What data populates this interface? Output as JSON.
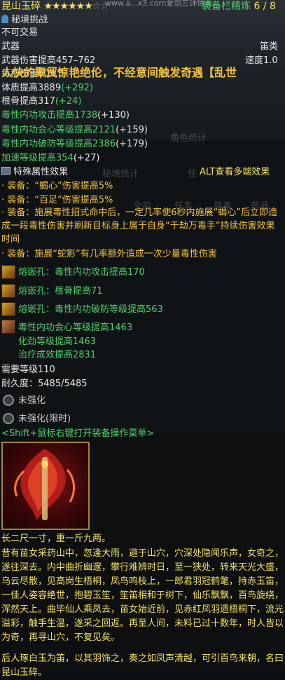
{
  "header": {
    "item_name": "昆山玉碎",
    "stars_filled": "★★★★★★",
    "stars_empty": "☆☆",
    "watermark": "www.a...x3.com爱剑三详情看...",
    "refine_label": "装备栏精炼",
    "refine_value": "6 / 8"
  },
  "source": "秘境挑战",
  "bind": "不可交易",
  "slot": "武器",
  "weapon_type": "笛类",
  "damage": "武器伤害提高457–762",
  "speed": "速度1.0",
  "banner": "人快的聚贸惊艳绝伦，不经意间触发奇遇【乱世",
  "ghost_text": "每秒伤害609.5",
  "stats": [
    {
      "base": "体质提高3889",
      "bonus": "(+292)",
      "color": "w"
    },
    {
      "base": "根骨提高317",
      "bonus": "(+24)",
      "color": "w"
    },
    {
      "base": "毒性内功攻击提高1738",
      "bonus": "(+130)",
      "color": "g"
    },
    {
      "base": "毒性内功会心等级提高2121",
      "bonus": "(+159)",
      "color": "g"
    },
    {
      "base": "毒性内功破防等级提高2386",
      "bonus": "(+179)",
      "color": "g"
    },
    {
      "base": "加速等级提高354",
      "bonus": "(+27)",
      "color": "g"
    }
  ],
  "background_tabs": {
    "role_stats": "角色统计",
    "secret_stats": "秘境统计",
    "cn_label": "任",
    "tabs": [
      "全部",
      "任务",
      "装备",
      "药品"
    ]
  },
  "special": {
    "title": "特殊属性效果",
    "alt_hint": "ALT查看多端效果",
    "effects": [
      "· 装备：“蝎心”伤害提高5%",
      "· 装备：“百足”伤害提高5%",
      "· 装备：施展毒性招式命中后，一定几率使6秒内施展“蝎心”后立即造成一段毒性伤害并刷新目标身上属于自身“千劫万毒手”持续伤害效果时间",
      "· 装备：施展“蛇影”有几率额外造成一次少量毒性伤害"
    ]
  },
  "sockets": [
    "熔嵌孔：毒性内功攻击提高170",
    "熔嵌孔：根骨提高71",
    "熔嵌孔：毒性内功破防等级提高563"
  ],
  "enchant": [
    "毒性内功会心等级提高1463",
    "化劲等级提高1463",
    "治疗成效提高2831"
  ],
  "level_req": "需要等级110",
  "durability": "耐久度：5485/5485",
  "strengthen": [
    "未强化",
    "未强化(限时)"
  ],
  "menu_hint": "<Shift+鼠标右键打开装备操作菜单>",
  "size_desc": "长二尺一寸，重一斤九两。",
  "lore": "昔有苗女采药山中，忽逢大雨，避于山穴，穴深处隐闻乐声，女奇之，遂往深去。内中曲折幽邃，攀行难辨时日，至一狭处，转来天光大盛，乌云尽散，见高岗生梧桐，凤鸟鸣枝上，一郎君羽冠鹤氅，持赤玉笛，一佳人姿容绝世，抱碧玉笙，笙笛相和于树下，仙乐飘飘，百鸟旋绕，浑然天上。曲毕仙人乘凤去，苗女始近前，见赤红凤羽遗梧桐下，流光溢彩，触手生温，遂采之回返。再至人间，未料已过十数年，时人皆以为奇，再寻山穴，不复见矣。",
  "lore2": "后人琢白玉为笛，以其羽饰之，奏之如凤声清越，可引百鸟来朝，名曰昆山玉碎。",
  "colors": {
    "yellow": "#f5e25e",
    "green": "#4fd06a",
    "white": "#e6e6e6",
    "orange": "#f3c13a",
    "cyan": "#4fd06a"
  }
}
